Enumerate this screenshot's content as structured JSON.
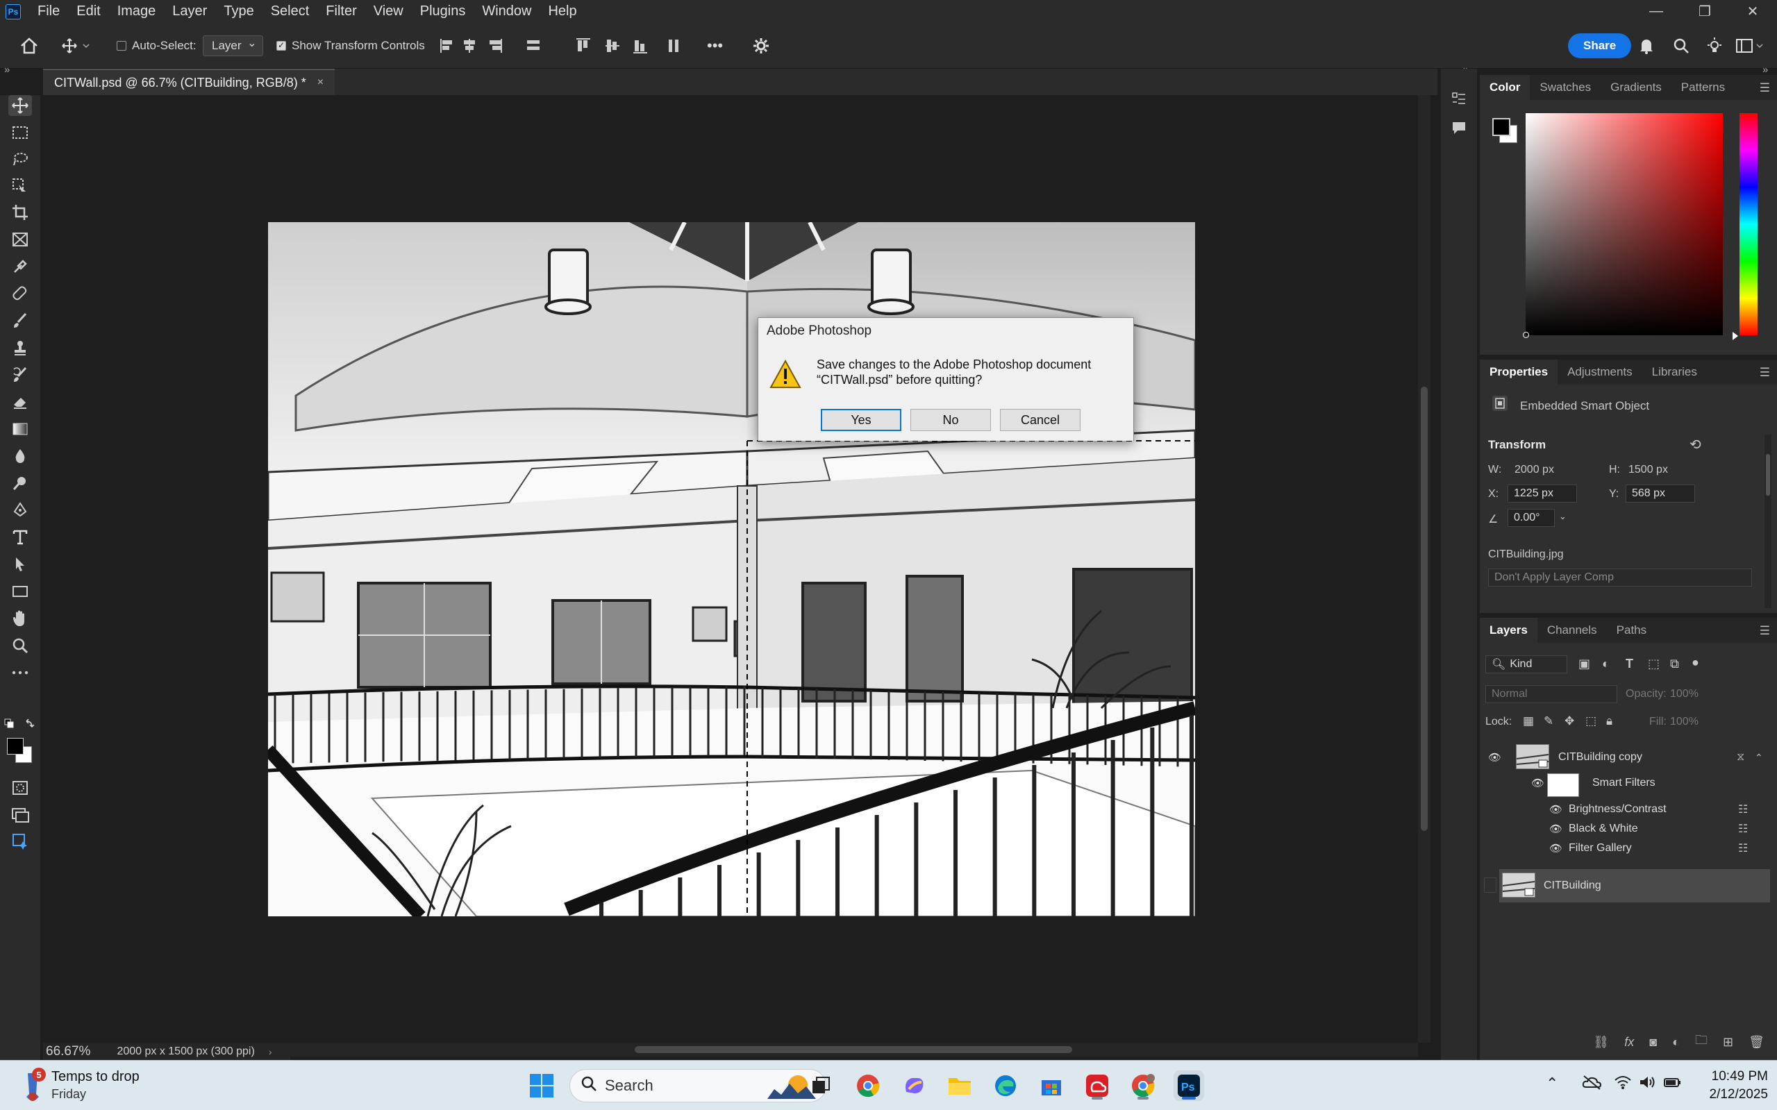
{
  "menubar": {
    "logo": "Ps",
    "items": [
      "File",
      "Edit",
      "Image",
      "Layer",
      "Type",
      "Select",
      "Filter",
      "View",
      "Plugins",
      "Window",
      "Help"
    ],
    "window_controls": [
      "—",
      "❐",
      "✕"
    ]
  },
  "options": {
    "auto_select_label": "Auto-Select:",
    "auto_select_checked": false,
    "layer_dropdown": "Layer",
    "transform_label": "Show Transform Controls",
    "transform_checked": true,
    "more": "•••",
    "share": "Share"
  },
  "document": {
    "tab_title": "CITWall.psd @ 66.7% (CITBuilding, RGB/8) *",
    "tab_close": "×",
    "zoom": "66.67%",
    "doc_info": "2000 px x 1500 px (300 ppi)"
  },
  "dialog": {
    "title": "Adobe Photoshop",
    "message_line1": "Save changes to the Adobe Photoshop document",
    "message_line2": "“CITWall.psd” before quitting?",
    "buttons": {
      "yes": "Yes",
      "no": "No",
      "cancel": "Cancel"
    },
    "default_button": "Yes"
  },
  "color_panel": {
    "tabs": [
      "Color",
      "Swatches",
      "Gradients",
      "Patterns"
    ],
    "active_tab": "Color",
    "hue_color": "#ff0000"
  },
  "properties_panel": {
    "tabs": [
      "Properties",
      "Adjustments",
      "Libraries"
    ],
    "active_tab": "Properties",
    "object_type": "Embedded Smart Object",
    "transform_heading": "Transform",
    "w_label": "W:",
    "w_value": "2000 px",
    "h_label": "H:",
    "h_value": "1500 px",
    "x_label": "X:",
    "x_value": "1225 px",
    "y_label": "Y:",
    "y_value": "568 px",
    "angle_value": "0.00°",
    "linked_file": "CITBuilding.jpg",
    "layer_comp": "Don't Apply Layer Comp"
  },
  "layers_panel": {
    "tabs": [
      "Layers",
      "Channels",
      "Paths"
    ],
    "active_tab": "Layers",
    "filter_kind": "Kind",
    "blend_mode": "Normal",
    "opacity_label": "Opacity:",
    "opacity_value": "100%",
    "lock_label": "Lock:",
    "fill_label": "Fill:",
    "fill_value": "100%",
    "layers": [
      {
        "name": "CITBuilding copy",
        "visible": true
      },
      {
        "name": "Smart Filters",
        "visible": true
      },
      {
        "name": "Brightness/Contrast",
        "visible": true
      },
      {
        "name": "Black & White",
        "visible": true
      },
      {
        "name": "Filter Gallery",
        "visible": true
      },
      {
        "name": "CITBuilding",
        "visible": false,
        "selected": true
      }
    ],
    "footer_icons": [
      "link-icon",
      "fx-icon",
      "mask-icon",
      "adjustment-icon",
      "folder-icon",
      "new-layer-icon",
      "trash-icon"
    ]
  },
  "taskbar": {
    "weather_badge": "5",
    "weather_line1": "Temps to drop",
    "weather_line2": "Friday",
    "search_placeholder": "Search",
    "time": "10:49 PM",
    "date": "2/12/2025"
  },
  "colors": {
    "ui_dark": "#2b2b2b",
    "canvas_bg": "#1e1e1e",
    "accent_blue": "#1473e6",
    "dialog_bg": "#f0f0f0"
  }
}
